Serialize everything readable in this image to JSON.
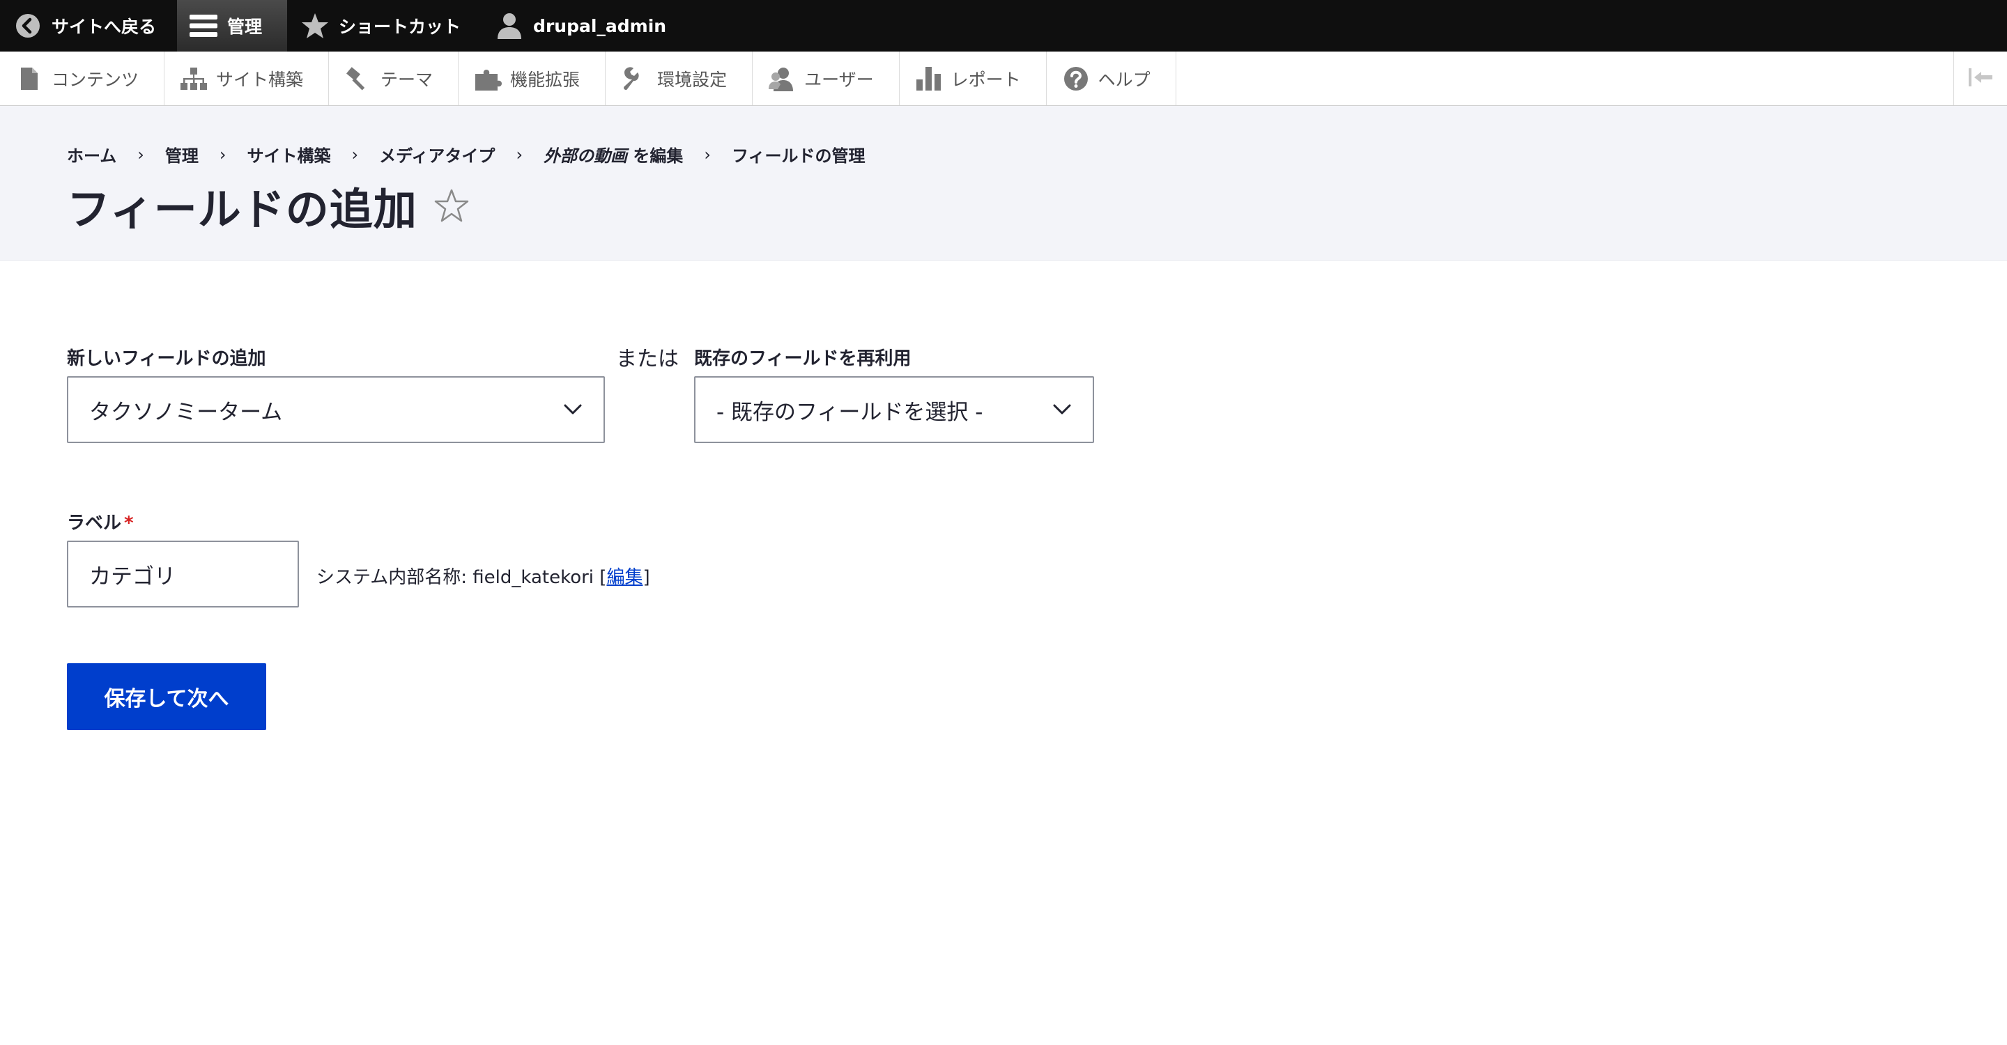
{
  "toolbar": {
    "back_to_site": "サイトへ戻る",
    "manage": "管理",
    "shortcuts": "ショートカット",
    "user": "drupal_admin"
  },
  "tray": {
    "items": [
      {
        "label": "コンテンツ",
        "icon": "file-icon"
      },
      {
        "label": "サイト構築",
        "icon": "sitemap-icon"
      },
      {
        "label": "テーマ",
        "icon": "paintbrush-icon"
      },
      {
        "label": "機能拡張",
        "icon": "puzzle-icon"
      },
      {
        "label": "環境設定",
        "icon": "wrench-icon"
      },
      {
        "label": "ユーザー",
        "icon": "people-icon"
      },
      {
        "label": "レポート",
        "icon": "bar-chart-icon"
      },
      {
        "label": "ヘルプ",
        "icon": "help-icon"
      }
    ]
  },
  "breadcrumb": {
    "items": [
      "ホーム",
      "管理",
      "サイト構築",
      "メディアタイプ"
    ],
    "edit_prefix_italic": "外部の動画",
    "edit_suffix": " を編集",
    "last": "フィールドの管理"
  },
  "page": {
    "title": "フィールドの追加"
  },
  "form": {
    "new_field_label": "新しいフィールドの追加",
    "new_field_value": "タクソノミーターム",
    "or_text": "または",
    "existing_field_label": "既存のフィールドを再利用",
    "existing_field_value": "- 既存のフィールドを選択 -",
    "label_label": "ラベル",
    "required_mark": "*",
    "label_value": "カテゴリ",
    "machine_name_prefix": "システム内部名称: field_katekori [",
    "machine_name_edit": "編集",
    "machine_name_suffix": "]",
    "submit_label": "保存して次へ"
  },
  "colors": {
    "toolbar_bg": "#0f0f0f",
    "header_bg": "#f3f4f9",
    "primary_button": "#003ecc",
    "required": "#d72222",
    "link": "#003ecc"
  }
}
